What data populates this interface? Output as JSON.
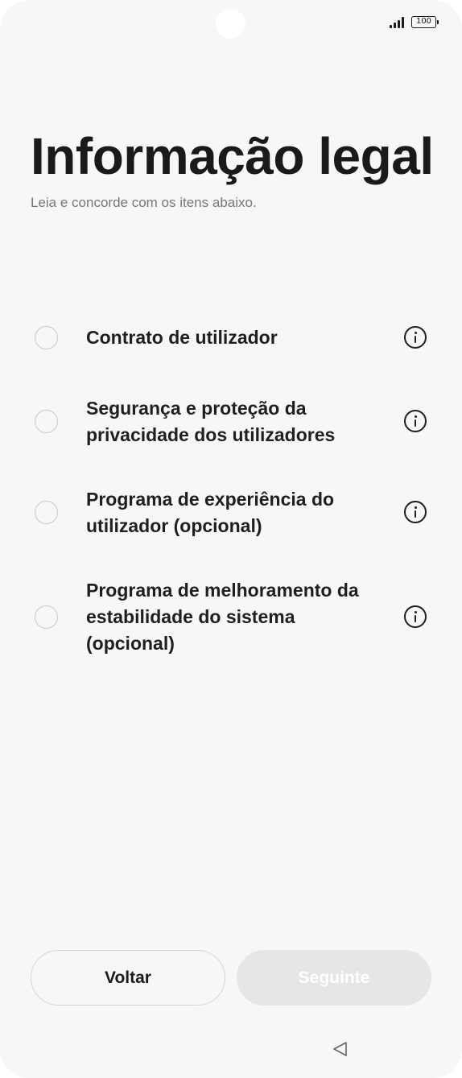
{
  "status_bar": {
    "battery_level": "100",
    "signal_icon": "signal-bars-icon",
    "battery_icon": "battery-icon"
  },
  "page": {
    "title": "Informação legal",
    "subtitle": "Leia e concorde com os itens abaixo."
  },
  "items": [
    {
      "label": "Contrato de utilizador",
      "checked": false,
      "info_icon": "info-icon"
    },
    {
      "label": "Segurança e proteção da privacidade dos utilizadores",
      "checked": false,
      "info_icon": "info-icon"
    },
    {
      "label": "Programa de experiência do utilizador (opcional)",
      "checked": false,
      "info_icon": "info-icon"
    },
    {
      "label": "Programa de melhoramento da estabilidade do sistema (opcional)",
      "checked": false,
      "info_icon": "info-icon"
    }
  ],
  "buttons": {
    "back_label": "Voltar",
    "next_label": "Seguinte",
    "next_enabled": false
  },
  "navigation": {
    "back_icon": "triangle-back-icon"
  },
  "colors": {
    "background": "#f7f7f7",
    "text_primary": "#1a1a1a",
    "text_secondary": "#777777",
    "disabled_button": "#e6e6e6"
  }
}
